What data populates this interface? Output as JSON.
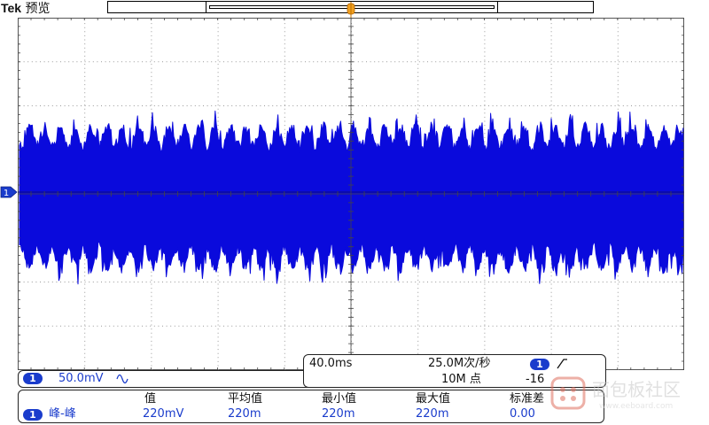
{
  "header": {
    "brand": "Tek",
    "mode": "预览"
  },
  "channel": {
    "marker_label": "1",
    "scale": "50.0mV",
    "coupling_icon": "sine-wave-icon"
  },
  "timebase": {
    "horizontal_scale": "40.0ms",
    "sample_rate": "25.0M次/秒",
    "record_length": "10M 点",
    "trigger_source": "1",
    "trigger_slope_icon": "rising-edge-icon",
    "trigger_level": "-16"
  },
  "measurements": {
    "headers": [
      "值",
      "平均值",
      "最小值",
      "最大值",
      "标准差"
    ],
    "rows": [
      {
        "source": "1",
        "name": "峰-峰",
        "values": [
          "220mV",
          "220m",
          "220m",
          "220m",
          "0.00"
        ]
      }
    ]
  },
  "watermark": {
    "text": "面包板社区",
    "subtext": "www.eeboard.com"
  },
  "colors": {
    "trace": "#0a0adc",
    "channel_badge": "#1a3ccc",
    "trigger_marker": "#f0a020",
    "grid": "#9a9a9a"
  }
}
